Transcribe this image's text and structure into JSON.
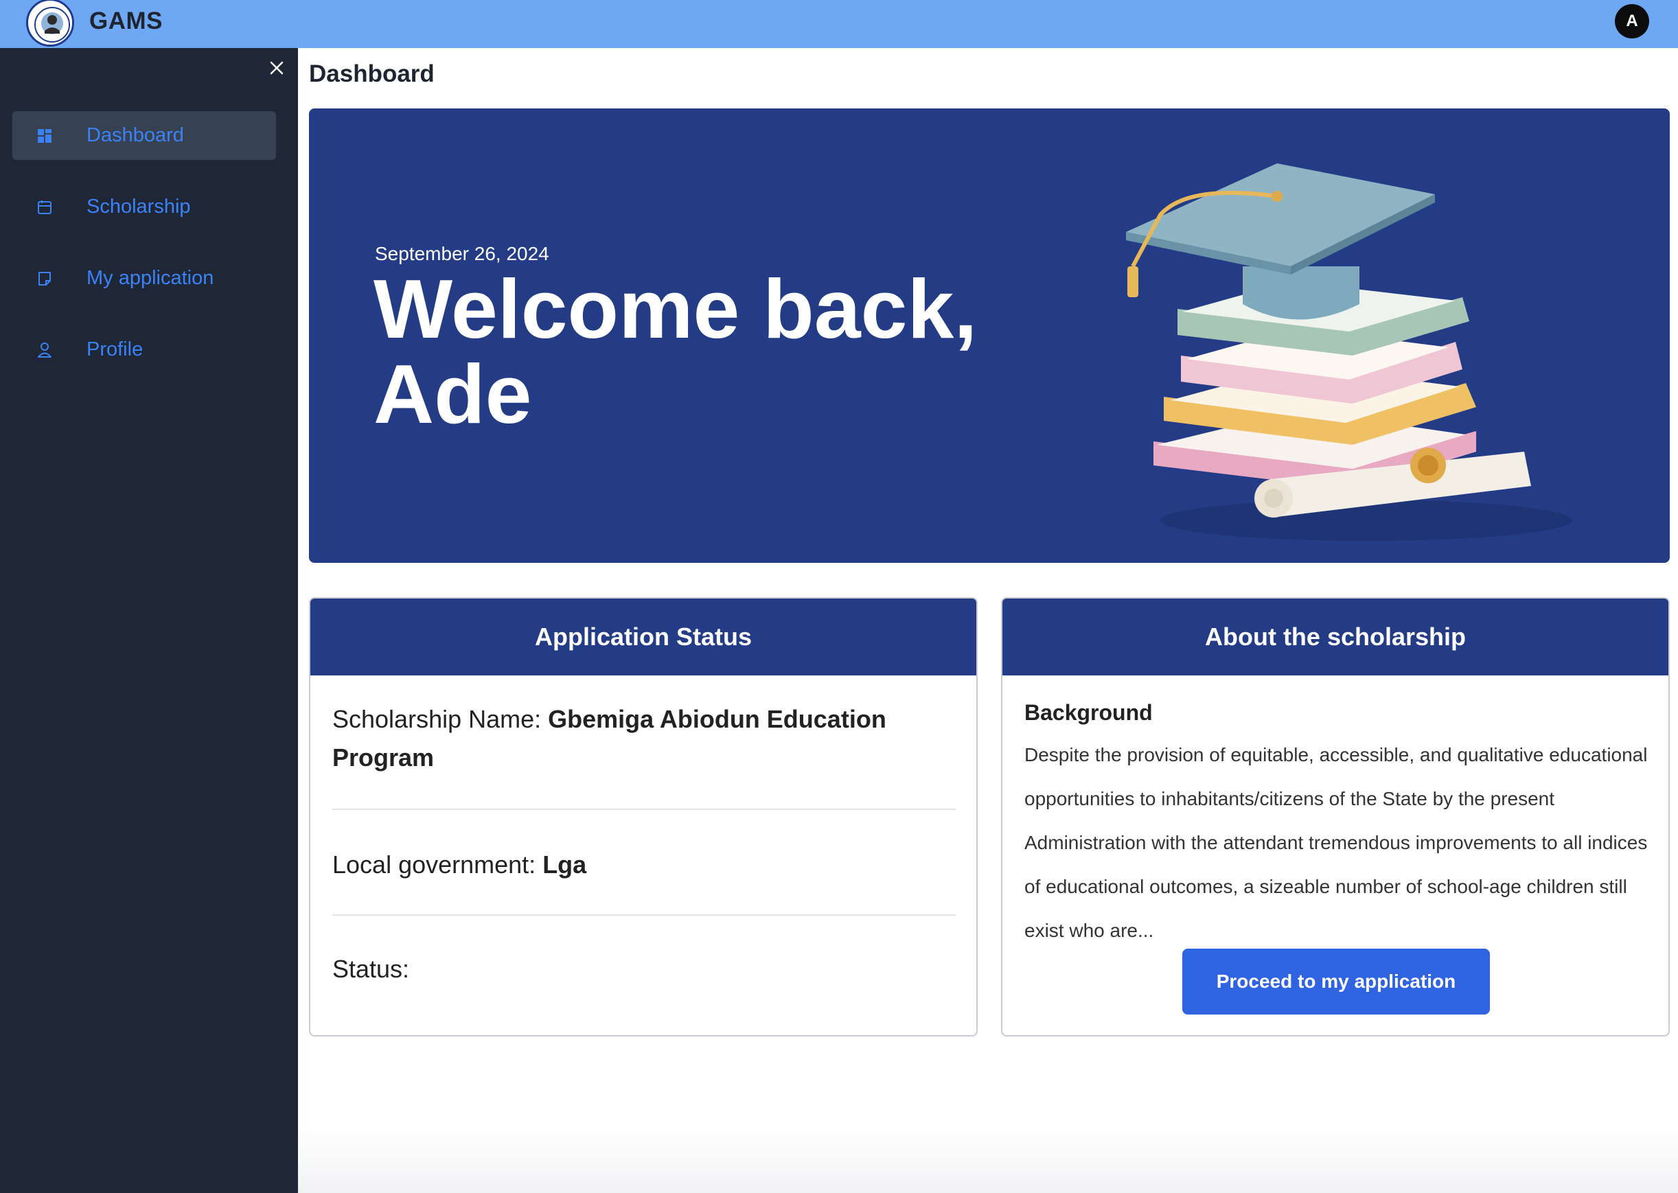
{
  "header": {
    "app_name": "GAMS",
    "avatar_initial": "A"
  },
  "sidebar": {
    "items": [
      {
        "label": "Dashboard",
        "icon": "dashboard-grid-icon",
        "active": true
      },
      {
        "label": "Scholarship",
        "icon": "calendar-icon",
        "active": false
      },
      {
        "label": "My application",
        "icon": "document-icon",
        "active": false
      },
      {
        "label": "Profile",
        "icon": "user-icon",
        "active": false
      }
    ]
  },
  "main": {
    "page_title": "Dashboard",
    "hero": {
      "date": "September 26, 2024",
      "welcome": "Welcome back, Ade"
    },
    "application_status": {
      "title": "Application Status",
      "scholarship_label": "Scholarship Name: ",
      "scholarship_value": "Gbemiga Abiodun Education Program",
      "lga_label": "Local government: ",
      "lga_value": "Lga",
      "status_label": "Status:",
      "status_value": ""
    },
    "about": {
      "title": "About the scholarship",
      "background_title": "Background",
      "background_text": "Despite the provision of equitable, accessible, and qualitative educational opportunities to inhabitants/citizens of the State by the present Administration with the attendant tremendous improvements to all indices of educational outcomes, a sizeable number of school-age children still exist who are...",
      "button_label": "Proceed to my application"
    }
  },
  "colors": {
    "topbar": "#6ea7f3",
    "sidebar": "#1f2736",
    "brand_navy": "#243c86",
    "link_blue": "#3b82f6",
    "button_blue": "#2f63e0"
  }
}
